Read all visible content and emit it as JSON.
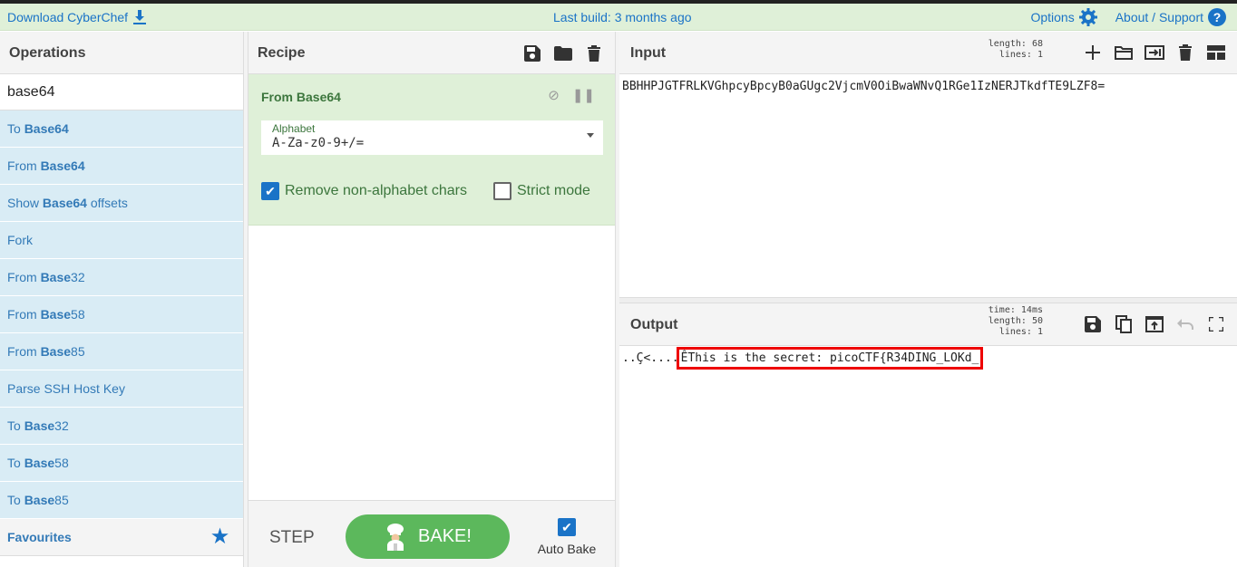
{
  "banner": {
    "download": "Download CyberChef",
    "last_build": "Last build: 3 months ago",
    "options": "Options",
    "about": "About / Support",
    "help_glyph": "?"
  },
  "operations": {
    "title": "Operations",
    "search_value": "base64",
    "items": [
      {
        "prefix": "To ",
        "bold": "Base64",
        "suffix": ""
      },
      {
        "prefix": "From ",
        "bold": "Base64",
        "suffix": ""
      },
      {
        "prefix": "Show ",
        "bold": "Base64",
        "suffix": " offsets"
      },
      {
        "prefix": "Fork",
        "bold": "",
        "suffix": ""
      },
      {
        "prefix": "From ",
        "bold": "Base",
        "suffix": "32"
      },
      {
        "prefix": "From ",
        "bold": "Base",
        "suffix": "58"
      },
      {
        "prefix": "From ",
        "bold": "Base",
        "suffix": "85"
      },
      {
        "prefix": "Parse SSH Host Key",
        "bold": "",
        "suffix": ""
      },
      {
        "prefix": "To ",
        "bold": "Base",
        "suffix": "32"
      },
      {
        "prefix": "To ",
        "bold": "Base",
        "suffix": "58"
      },
      {
        "prefix": "To ",
        "bold": "Base",
        "suffix": "85"
      }
    ],
    "favourites": "Favourites"
  },
  "recipe": {
    "title": "Recipe",
    "operation": {
      "name": "From Base64",
      "alphabet_label": "Alphabet",
      "alphabet_value": "A-Za-z0-9+/=",
      "remove_label": "Remove non-alphabet chars",
      "remove_checked": true,
      "strict_label": "Strict mode",
      "strict_checked": false
    },
    "step_label": "STEP",
    "bake_label": "BAKE!",
    "auto_bake_label": "Auto Bake",
    "auto_bake_checked": true
  },
  "input": {
    "title": "Input",
    "length_label": "length:",
    "length": "68",
    "lines_label": "lines:",
    "lines": "1",
    "text": "BBHHPJGTFRLKVGhpcyBpcyB0aGUgc2VjcmV0OiBwaWNvQ1RGe1IzNERJTkdfTE9LZF8="
  },
  "output": {
    "title": "Output",
    "time_label": "time:",
    "time": "14ms",
    "length_label": "length:",
    "length": "50",
    "lines_label": "lines:",
    "lines": "1",
    "text_prefix": "..Ç<....",
    "text_highlight": "ÊThis is the secret: picoCTF{R34DING_LOKd_"
  },
  "colors": {
    "banner_bg": "#dff0d8",
    "op_item_bg": "#d9ecf5",
    "link": "#1a73c7",
    "bake": "#5cb85c",
    "highlight_box": "#e00000"
  }
}
